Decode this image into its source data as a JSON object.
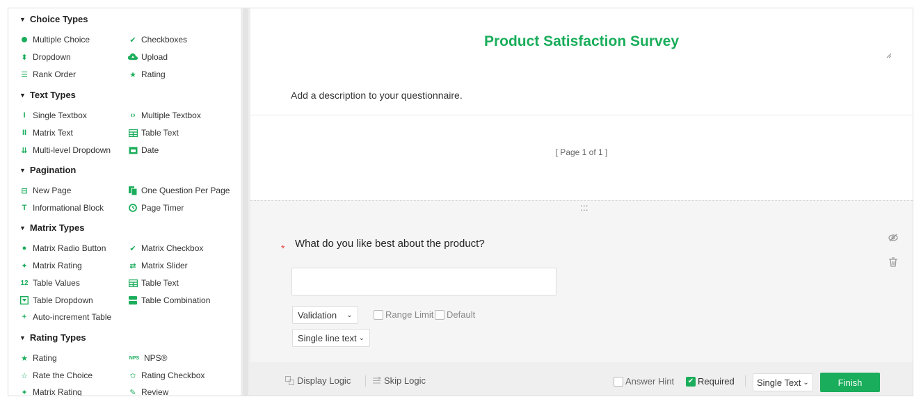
{
  "survey": {
    "title": "Product Satisfaction Survey",
    "description": "Add a description to your questionnaire.",
    "page_label": "[ Page 1 of 1 ]"
  },
  "sidebar": {
    "sections": [
      {
        "title": "Choice Types"
      },
      {
        "title": "Text Types"
      },
      {
        "title": "Pagination"
      },
      {
        "title": "Matrix Types"
      },
      {
        "title": "Rating Types"
      }
    ],
    "items": {
      "multiple_choice": "Multiple Choice",
      "checkboxes": "Checkboxes",
      "dropdown": "Dropdown",
      "upload": "Upload",
      "rank_order": "Rank Order",
      "rating": "Rating",
      "single_textbox": "Single Textbox",
      "multiple_textbox": "Multiple Textbox",
      "matrix_text": "Matrix Text",
      "table_text": "Table Text",
      "multilevel_dropdown": "Multi-level Dropdown",
      "date": "Date",
      "new_page": "New Page",
      "one_question_per_page": "One Question Per Page",
      "informational_block": "Informational Block",
      "page_timer": "Page Timer",
      "matrix_radio_button": "Matrix Radio Button",
      "matrix_checkbox": "Matrix Checkbox",
      "matrix_rating": "Matrix Rating",
      "matrix_slider": "Matrix Slider",
      "table_values": "Table Values",
      "table_text_2": "Table Text",
      "table_dropdown": "Table Dropdown",
      "table_combination": "Table Combination",
      "auto_increment_table": "Auto-increment Table",
      "rating_2": "Rating",
      "nps": "NPS®",
      "rate_the_choice": "Rate the Choice",
      "rating_checkbox": "Rating Checkbox",
      "matrix_rating_2": "Matrix Rating",
      "review": "Review"
    },
    "icon_text": {
      "table_values": "12",
      "nps": "NPS"
    }
  },
  "question": {
    "text": "What do you like best about the product?",
    "required_marker": "*",
    "answer_value": "",
    "validation_label": "Validation",
    "range_limit_label": "Range Limit",
    "default_label": "Default",
    "line_type_label": "Single line text",
    "drag_handle": ":::"
  },
  "footer": {
    "display_logic": "Display Logic",
    "skip_logic": "Skip Logic",
    "answer_hint": "Answer Hint",
    "required": "Required",
    "question_type": "Single Text",
    "finish": "Finish"
  },
  "colors": {
    "accent": "#1aad5b",
    "required_star": "#ee4444"
  }
}
